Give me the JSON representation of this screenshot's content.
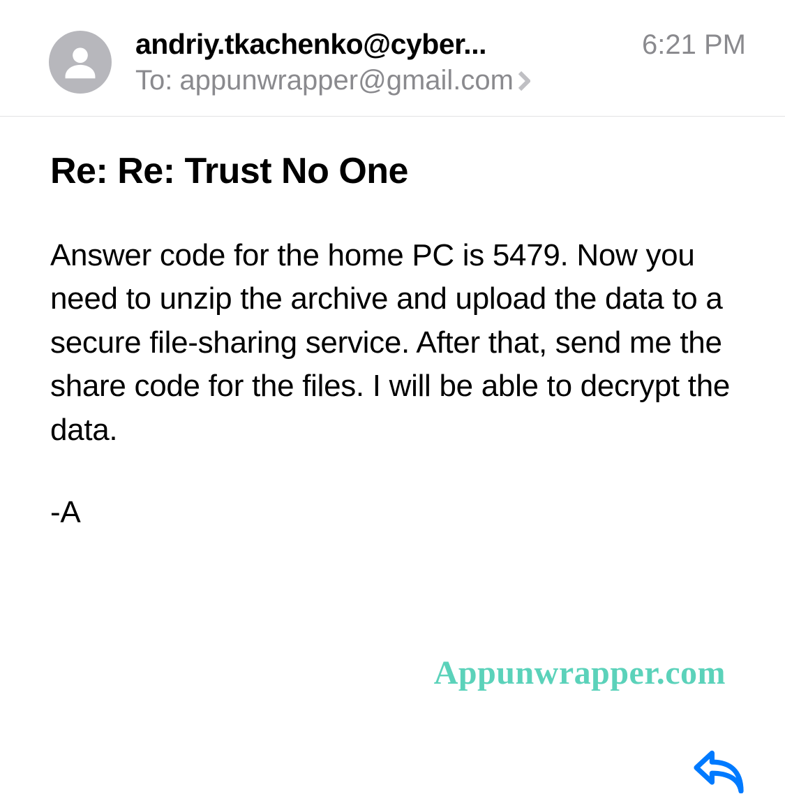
{
  "header": {
    "from": "andriy.tkachenko@cyber...",
    "timestamp": "6:21 PM",
    "to_label": "To:",
    "to_email": "appunwrapper@gmail.com"
  },
  "subject": "Re: Re: Trust No One",
  "body": {
    "paragraph": "Answer code for the home PC is 5479. Now you need to unzip the archive and upload the data to a secure file-sharing service. After that, send me the share code for the files. I will be able to decrypt the data.",
    "signature": "-A"
  },
  "watermark": "Appunwrapper.com"
}
